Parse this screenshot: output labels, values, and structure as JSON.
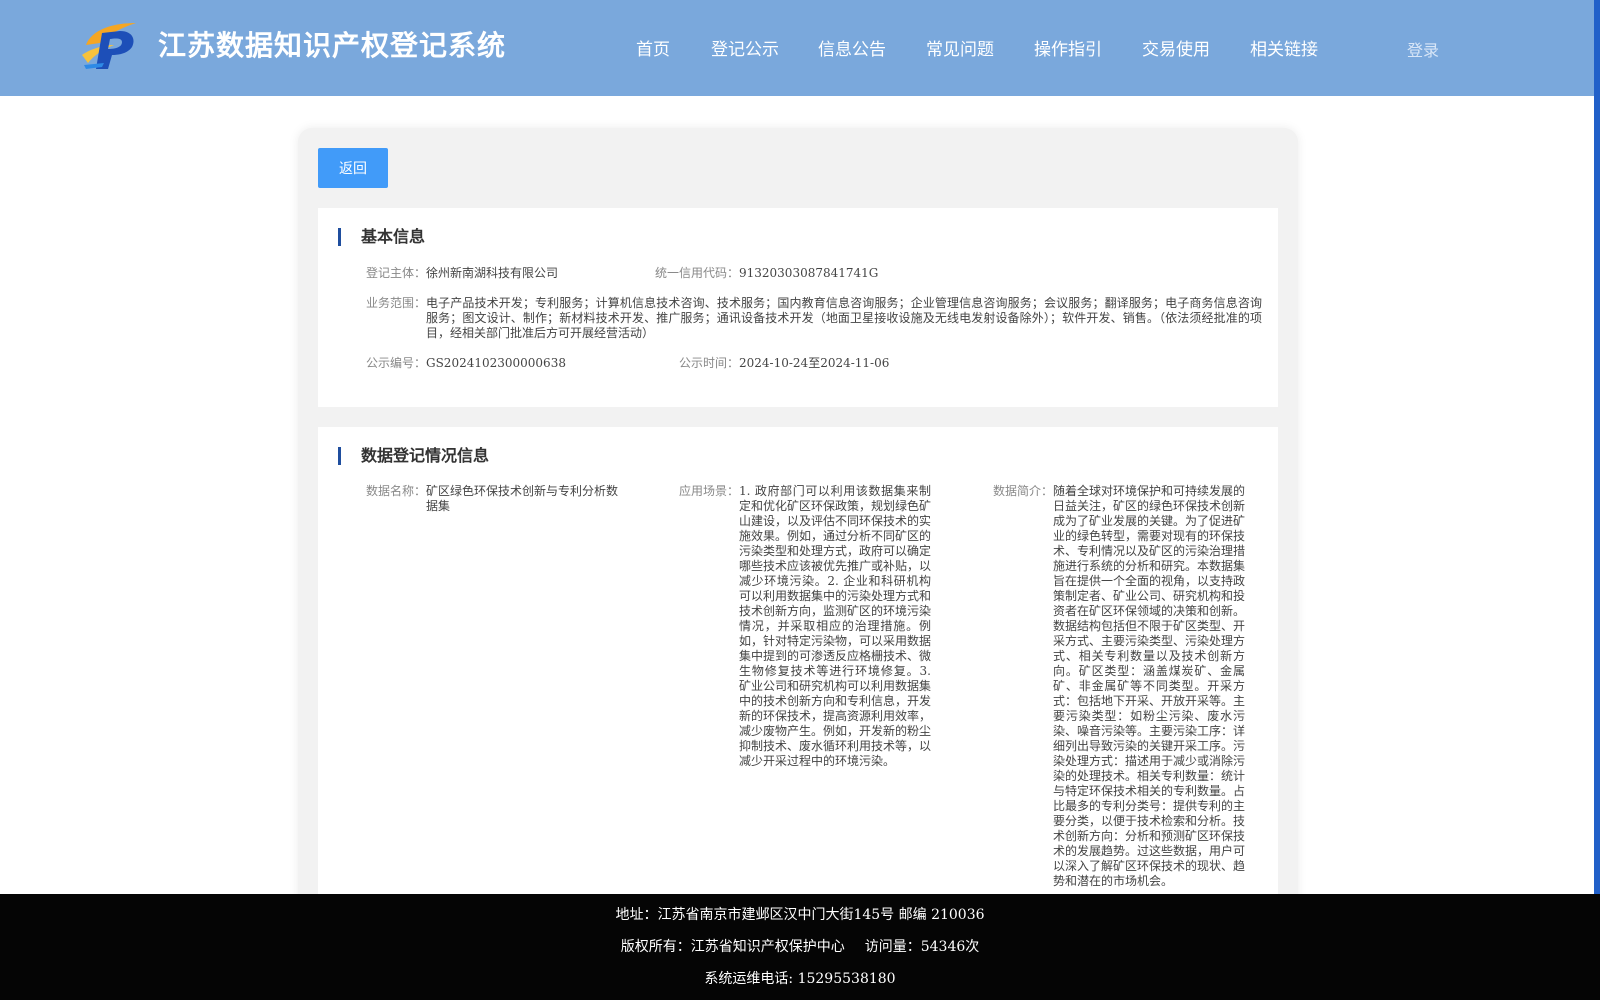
{
  "header": {
    "logo_icon": "ip-logo-icon",
    "title": "江苏数据知识产权登记系统",
    "nav": [
      "首页",
      "登记公示",
      "信息公告",
      "常见问题",
      "操作指引",
      "交易使用",
      "相关链接"
    ],
    "login": "登录",
    "colors": {
      "header_bg": "#7aa8dc",
      "accent_edge": "#2160c9"
    }
  },
  "toolbar": {
    "back_label": "返回"
  },
  "basic_info": {
    "title": "基本信息",
    "subject_label": "登记主体：",
    "subject_value": "徐州新南湖科技有限公司",
    "credit_label": "统一信用代码：",
    "credit_value": "91320303087841741G",
    "scope_label": "业务范围：",
    "scope_value": "电子产品技术开发；专利服务；计算机信息技术咨询、技术服务；国内教育信息咨询服务；企业管理信息咨询服务；会议服务；翻译服务；电子商务信息咨询服务；图文设计、制作；新材料技术开发、推广服务；通讯设备技术开发（地面卫星接收设施及无线电发射设备除外）；软件开发、销售。（依法须经批准的项目，经相关部门批准后方可开展经营活动）",
    "pub_no_label": "公示编号：",
    "pub_no_value": "GS2024102300000638",
    "pub_time_label": "公示时间：",
    "pub_time_value": "2024-10-24至2024-11-06"
  },
  "data_info": {
    "title": "数据登记情况信息",
    "name_label": "数据名称：",
    "name_value": "矿区绿色环保技术创新与专利分析数据集",
    "scene_label": "应用场景：",
    "scene_value": "1. 政府部门可以利用该数据集来制定和优化矿区环保政策，规划绿色矿山建设，以及评估不同环保技术的实施效果。例如，通过分析不同矿区的污染类型和处理方式，政府可以确定哪些技术应该被优先推广或补贴，以减少环境污染。2. 企业和科研机构可以利用数据集中的污染处理方式和技术创新方向，监测矿区的环境污染情况，并采取相应的治理措施。例如，针对特定污染物，可以采用数据集中提到的可渗透反应格栅技术、微生物修复技术等进行环境修复。3. 矿业公司和研究机构可以利用数据集中的技术创新方向和专利信息，开发新的环保技术，提高资源利用效率，减少废物产生。例如，开发新的粉尘抑制技术、废水循环利用技术等，以减少开采过程中的环境污染。",
    "intro_label": "数据简介：",
    "intro_value": "随着全球对环境保护和可持续发展的日益关注，矿区的绿色环保技术创新成为了矿业发展的关键。为了促进矿业的绿色转型，需要对现有的环保技术、专利情况以及矿区的污染治理措施进行系统的分析和研究。本数据集旨在提供一个全面的视角，以支持政策制定者、矿业公司、研究机构和投资者在矿区环保领域的决策和创新。数据结构包括但不限于矿区类型、开采方式、主要污染类型、污染处理方式、相关专利数量以及技术创新方向。矿区类型：涵盖煤炭矿、金属矿、非金属矿等不同类型。开采方式：包括地下开采、开放开采等。主要污染类型：如粉尘污染、废水污染、噪音污染等。主要污染工序：详细列出导致污染的关键开采工序。污染处理方式：描述用于减少或消除污染的处理技术。相关专利数量：统计与特定环保技术相关的专利数量。占比最多的专利分类号：提供专利的主要分类，以便于技术检索和分析。技术创新方向：分析和预测矿区环保技术的发展趋势。过这些数据，用户可以深入了解矿区环保技术的现状、趋势和潜在的市场机会。"
  },
  "footer": {
    "address": "地址：江苏省南京市建邺区汉中门大街145号 邮编 210036",
    "copyright": "版权所有：江苏省知识产权保护中心",
    "visits": "访问量：54346次",
    "phone": "系统运维电话: 15295538180"
  }
}
